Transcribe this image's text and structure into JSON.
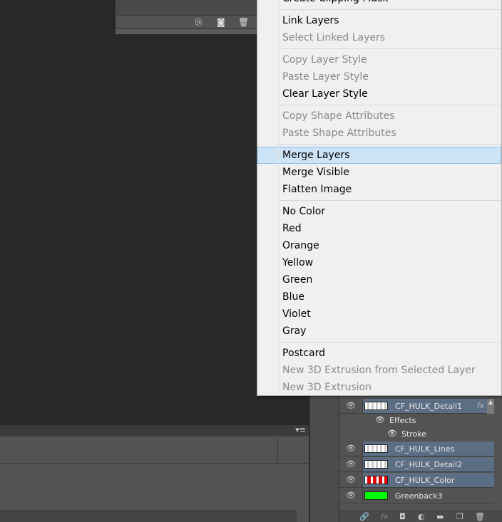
{
  "top_panel": {
    "icons": [
      "new-snapshot-icon",
      "camera-icon",
      "trash-icon"
    ]
  },
  "context_menu": {
    "partial_top_item": "Create Clipping Mask",
    "groups": [
      [
        {
          "label": "Link Layers",
          "enabled": true
        },
        {
          "label": "Select Linked Layers",
          "enabled": false
        }
      ],
      [
        {
          "label": "Copy Layer Style",
          "enabled": false
        },
        {
          "label": "Paste Layer Style",
          "enabled": false
        },
        {
          "label": "Clear Layer Style",
          "enabled": true
        }
      ],
      [
        {
          "label": "Copy Shape Attributes",
          "enabled": false
        },
        {
          "label": "Paste Shape Attributes",
          "enabled": false
        }
      ],
      [
        {
          "label": "Merge Layers",
          "enabled": true,
          "highlighted": true
        },
        {
          "label": "Merge Visible",
          "enabled": true
        },
        {
          "label": "Flatten Image",
          "enabled": true
        }
      ],
      [
        {
          "label": "No Color",
          "enabled": true
        },
        {
          "label": "Red",
          "enabled": true
        },
        {
          "label": "Orange",
          "enabled": true
        },
        {
          "label": "Yellow",
          "enabled": true
        },
        {
          "label": "Green",
          "enabled": true
        },
        {
          "label": "Blue",
          "enabled": true
        },
        {
          "label": "Violet",
          "enabled": true
        },
        {
          "label": "Gray",
          "enabled": true
        }
      ],
      [
        {
          "label": "Postcard",
          "enabled": true
        },
        {
          "label": "New 3D Extrusion from Selected Layer",
          "enabled": false
        },
        {
          "label": "New 3D Extrusion",
          "enabled": false
        }
      ]
    ]
  },
  "layers": {
    "rows": [
      {
        "name": "CF_HULK_Detail1",
        "selected": true,
        "fx": "fx"
      },
      {
        "name": "CF_HULK_Lines",
        "selected": true
      },
      {
        "name": "CF_HULK_Detail2",
        "selected": true
      },
      {
        "name": "CF_HULK_Color",
        "selected": true
      },
      {
        "name": "Greenback3",
        "selected": false,
        "thumb_color": "#00ff00"
      }
    ],
    "effects_label": "Effects",
    "stroke_label": "Stroke",
    "fx_footer": "fx"
  },
  "colors": {
    "highlight": "#cde3f6",
    "selected_layer": "#5c6e84"
  }
}
